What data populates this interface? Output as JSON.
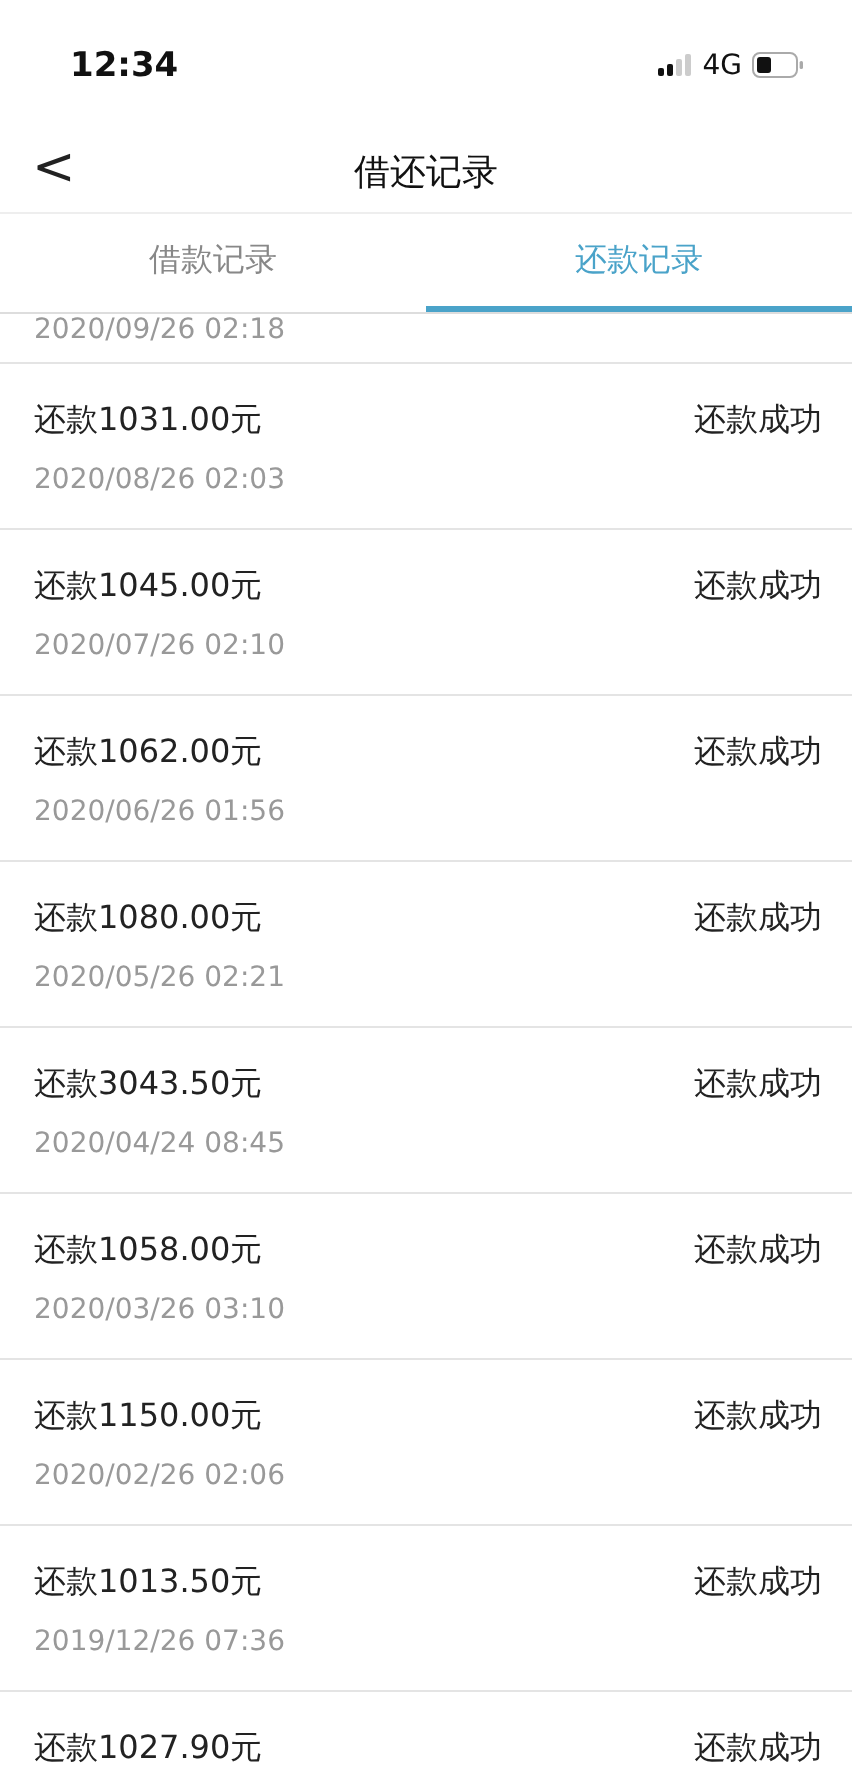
{
  "status_bar": {
    "time": "12:34",
    "network": "4G"
  },
  "nav": {
    "back": "<",
    "title": "借还记录"
  },
  "tabs": [
    {
      "label": "借款记录",
      "selected": false
    },
    {
      "label": "还款记录",
      "selected": true
    }
  ],
  "records": [
    {
      "date": "2020/09/26 02:18"
    },
    {
      "amount": "还款1031.00元",
      "status": "还款成功",
      "date": "2020/08/26 02:03"
    },
    {
      "amount": "还款1045.00元",
      "status": "还款成功",
      "date": "2020/07/26 02:10"
    },
    {
      "amount": "还款1062.00元",
      "status": "还款成功",
      "date": "2020/06/26 01:56"
    },
    {
      "amount": "还款1080.00元",
      "status": "还款成功",
      "date": "2020/05/26 02:21"
    },
    {
      "amount": "还款3043.50元",
      "status": "还款成功",
      "date": "2020/04/24 08:45"
    },
    {
      "amount": "还款1058.00元",
      "status": "还款成功",
      "date": "2020/03/26 03:10"
    },
    {
      "amount": "还款1150.00元",
      "status": "还款成功",
      "date": "2020/02/26 02:06"
    },
    {
      "amount": "还款1013.50元",
      "status": "还款成功",
      "date": "2019/12/26 07:36"
    },
    {
      "amount": "还款1027.90元",
      "status": "还款成功"
    }
  ]
}
